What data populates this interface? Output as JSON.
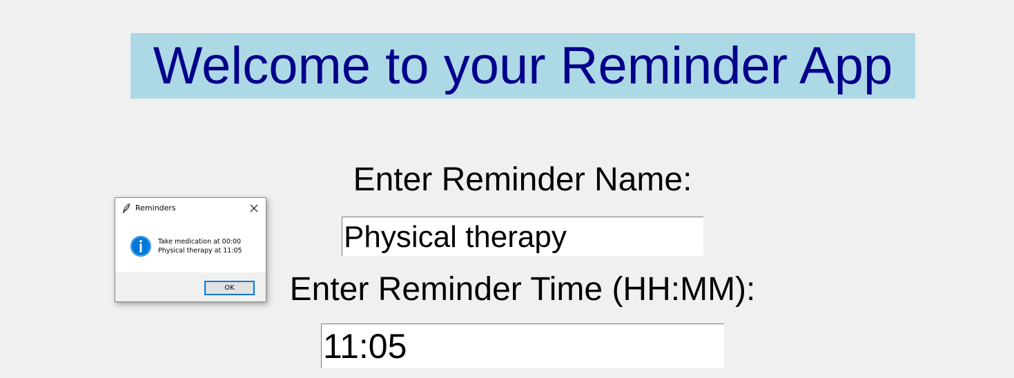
{
  "main_window": {
    "title": "Welcome to your Reminder App",
    "name_label": "Enter Reminder Name:",
    "name_value": "Physical therapy",
    "time_label": "Enter Reminder Time (HH:MM):",
    "time_value": "11:05"
  },
  "message_box": {
    "title": "Reminders",
    "lines": [
      "Take medication at 00:00",
      "Physical therapy at 11:05"
    ],
    "ok_label": "OK",
    "icon": "info-icon",
    "window_icon": "feather-icon"
  },
  "colors": {
    "background": "#f0f0f0",
    "title_background": "#add8e6",
    "title_text": "#00008b",
    "info_icon": "#0078d7",
    "button_focus_border": "#0078d7"
  }
}
